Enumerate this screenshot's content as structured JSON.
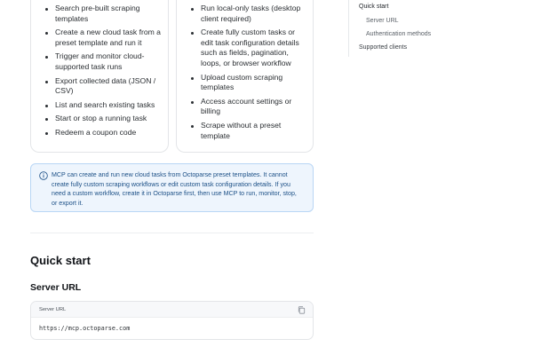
{
  "can_do": {
    "items": [
      "Search pre-built scraping templates",
      "Create a new cloud task from a preset template and run it",
      "Trigger and monitor cloud-supported task runs",
      "Export collected data (JSON / CSV)",
      "List and search existing tasks",
      "Start or stop a running task",
      "Redeem a coupon code"
    ]
  },
  "cannot_do": {
    "items": [
      "Run local-only tasks (desktop client required)",
      "Create fully custom tasks or edit task configuration details such as fields, pagination, loops, or browser workflow",
      "Upload custom scraping templates",
      "Access account settings or billing",
      "Scrape without a preset template"
    ]
  },
  "callout": {
    "icon": "info-icon",
    "text": "MCP can create and run new cloud tasks from Octoparse preset templates. It cannot create fully custom scraping workflows or edit custom task configuration details. If you need a custom workflow, create it in Octoparse first, then use MCP to run, monitor, stop, or export it."
  },
  "quick_start": {
    "heading": "Quick start",
    "server_url_heading": "Server URL",
    "code_block": {
      "title": "Server URL",
      "code": "https://mcp.octoparse.com",
      "copy_icon": "copy-icon"
    }
  },
  "toc": {
    "items": [
      {
        "label": "Quick start"
      },
      {
        "label": "Server URL"
      },
      {
        "label": "Authentication methods"
      }
    ],
    "next": "Supported clients"
  },
  "colors": {
    "callout_bg": "#eef5fd",
    "callout_border": "#b9d6f5",
    "callout_text": "#1b4f86"
  }
}
